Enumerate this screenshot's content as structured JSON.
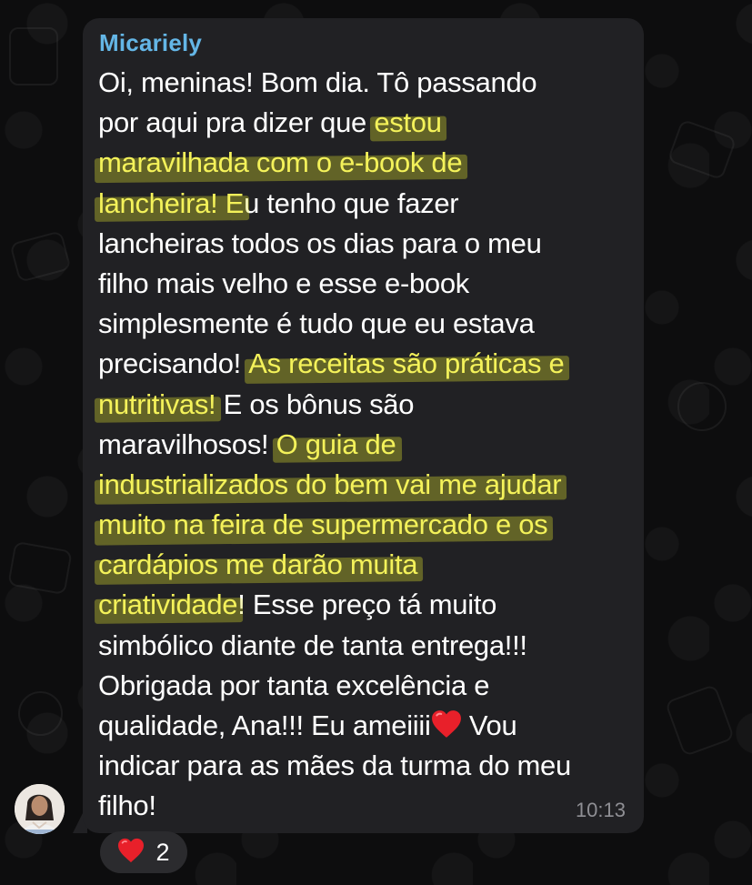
{
  "message": {
    "sender": "Micariely",
    "lines": [
      [
        {
          "t": "Oi, meninas! Bom dia. Tô passando",
          "h": false
        }
      ],
      [
        {
          "t": "por aqui pra dizer que ",
          "h": false
        },
        {
          "t": "estou",
          "h": true
        }
      ],
      [
        {
          "t": "maravilhada com o e-book de",
          "h": true
        }
      ],
      [
        {
          "t": "lancheira! E",
          "h": true
        },
        {
          "t": "u tenho que fazer",
          "h": false
        }
      ],
      [
        {
          "t": "lancheiras todos os dias para o meu",
          "h": false
        }
      ],
      [
        {
          "t": "filho mais velho e esse e-book",
          "h": false
        }
      ],
      [
        {
          "t": "simplesmente é tudo que eu estava",
          "h": false
        }
      ],
      [
        {
          "t": "precisando! ",
          "h": false
        },
        {
          "t": "As receitas são práticas e",
          "h": true
        }
      ],
      [
        {
          "t": "nutritivas!",
          "h": true
        },
        {
          "t": " E os bônus são",
          "h": false
        }
      ],
      [
        {
          "t": "maravilhosos! ",
          "h": false
        },
        {
          "t": "O guia de",
          "h": true
        }
      ],
      [
        {
          "t": "industrializados do bem vai me ajudar",
          "h": true
        }
      ],
      [
        {
          "t": "muito na feira de supermercado e os",
          "h": true
        }
      ],
      [
        {
          "t": "cardápios me darão muita",
          "h": true
        }
      ],
      [
        {
          "t": "criatividade",
          "h": true
        },
        {
          "t": "! Esse preço tá muito",
          "h": false
        }
      ],
      [
        {
          "t": "simbólico diante de tanta entrega!!!",
          "h": false
        }
      ],
      [
        {
          "t": "Obrigada por tanta excelência e",
          "h": false
        }
      ],
      [
        {
          "t": "qualidade, Ana!!! Eu ameiiii",
          "h": false
        },
        {
          "t": "[heart]",
          "h": false
        },
        {
          "t": " Vou",
          "h": false
        }
      ],
      [
        {
          "t": "indicar para as mães da turma do meu",
          "h": false
        }
      ],
      [
        {
          "t": "filho!",
          "h": false
        }
      ]
    ],
    "time": "10:13"
  },
  "reaction": {
    "emoji_icon": "red-heart-icon",
    "count": "2"
  },
  "colors": {
    "sender": "#64b6e6",
    "bubble": "#212124",
    "highlight": "#e8ea2e"
  }
}
